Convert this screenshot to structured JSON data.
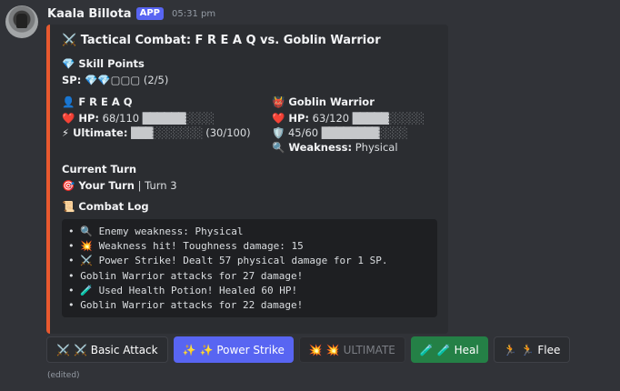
{
  "message": {
    "username": "Kaala Billota",
    "badge": "APP",
    "timestamp": "05:31 pm",
    "edited": "(edited)"
  },
  "embed": {
    "accent_color": "#e8592f",
    "title": "⚔️ Tactical Combat: 𝗙 𝗥 𝗘 𝗔 𝗤 vs. Goblin Warrior",
    "skill_points_label": "💎 Skill Points",
    "sp_label": "SP:",
    "sp_value": "💎💎▢▢▢ (2/5)",
    "player": {
      "name": "👤 𝗙 𝗥 𝗘 𝗔 𝗤",
      "hp_label": "❤️ HP:",
      "hp_value": "68/110",
      "hp_bar_filled": "██████",
      "hp_bar_empty": "░░░░",
      "ult_label": "⚡ Ultimate:",
      "ult_bar_filled": "███",
      "ult_bar_empty": "░░░░░░░",
      "ult_value": "(30/100)"
    },
    "enemy": {
      "name": "👹 Goblin Warrior",
      "hp_label": "❤️ HP:",
      "hp_value": "63/120",
      "hp_bar_filled": "█████",
      "hp_bar_empty": "░░░░░",
      "shield_icon": "🛡️",
      "shield_value": "45/60",
      "shield_bar_filled": "████████",
      "shield_bar_empty": "░░░░",
      "weakness_label": "🔍 Weakness:",
      "weakness_value": "Physical"
    },
    "current_turn_label": "Current Turn",
    "turn_who": "🎯 Your Turn",
    "turn_number": "| Turn 3",
    "combat_log_label": "📜 Combat Log",
    "combat_log": [
      "• 🔍 Enemy weakness: Physical",
      "• 💥 Weakness hit! Toughness damage: 15",
      "• ⚔️ Power Strike! Dealt 57 physical damage for 1 SP.",
      "• Goblin Warrior attacks for 27 damage!",
      "• 🧪 Used Health Potion! Healed 60 HP!",
      "• Goblin Warrior attacks for 22 damage!"
    ]
  },
  "buttons": [
    {
      "icon": "⚔️",
      "label": "⚔️ Basic Attack",
      "style": "secondary"
    },
    {
      "icon": "✨",
      "label": "✨ Power Strike",
      "style": "primary"
    },
    {
      "icon": "💥",
      "label": "💥 ULTIMATE",
      "style": "disabled"
    },
    {
      "icon": "🧪",
      "label": "🧪 Heal",
      "style": "success"
    },
    {
      "icon": "🏃",
      "label": "🏃 Flee",
      "style": "secondary"
    }
  ]
}
